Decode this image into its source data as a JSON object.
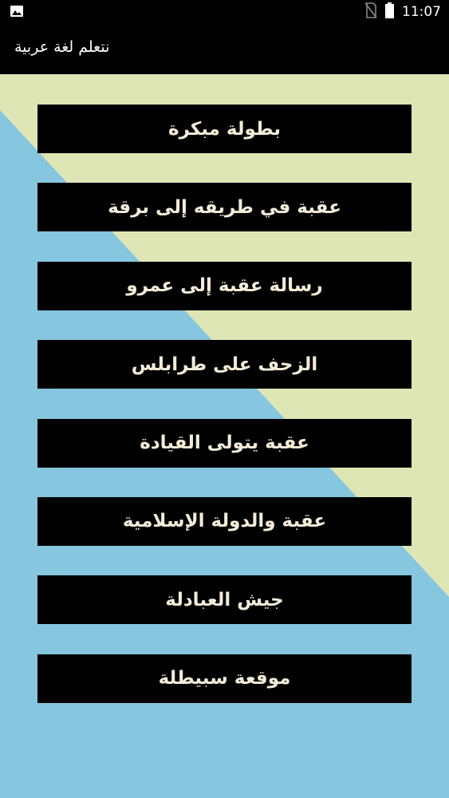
{
  "status_bar": {
    "time": "11:07",
    "icons": [
      "image-notification-icon",
      "no-sim-icon",
      "battery-icon"
    ]
  },
  "app_bar": {
    "title": "نتعلم لغة عربية"
  },
  "colors": {
    "bar_background": "#000000",
    "background_cream": "#dfe6b5",
    "background_blue": "#86c6df",
    "button_background": "#000000",
    "button_text": "#f2ecd8"
  },
  "menu": {
    "items": [
      {
        "label": "بطولة مبكرة"
      },
      {
        "label": "عقبة في طريقه إلى برقة"
      },
      {
        "label": "رسالة عقبة إلى عمرو"
      },
      {
        "label": "الزحف على طرابلس"
      },
      {
        "label": "عقبة يتولى القيادة"
      },
      {
        "label": "عقبة والدولة الإسلامية"
      },
      {
        "label": "جيش العبادلة"
      },
      {
        "label": "موقعة سبيطلة"
      }
    ]
  }
}
